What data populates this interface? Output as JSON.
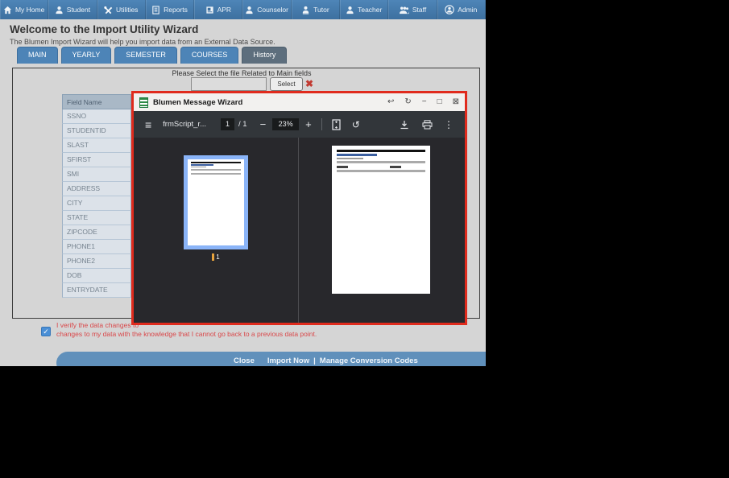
{
  "colors": {
    "navbar_blue": "#4a7fb3",
    "tab_blue": "#4d85b8",
    "tab_active_gray": "#5d6e7d",
    "footer_blue": "#6090bb",
    "alert_red": "#d9484a",
    "modal_border_red": "#e02b1d",
    "pdf_toolbar_dark": "#32363a",
    "thumbnail_selection_blue": "#8ab4f8"
  },
  "navbar": {
    "items": [
      {
        "label": "My Home",
        "icon": "home-icon"
      },
      {
        "label": "Student",
        "icon": "person-icon"
      },
      {
        "label": "Utilities",
        "icon": "tools-icon"
      },
      {
        "label": "Reports",
        "icon": "report-icon"
      },
      {
        "label": "APR",
        "icon": "book-icon"
      },
      {
        "label": "Counselor",
        "icon": "person-icon"
      },
      {
        "label": "Tutor",
        "icon": "person-icon"
      },
      {
        "label": "Teacher",
        "icon": "person-icon"
      },
      {
        "label": "Staff",
        "icon": "people-icon"
      },
      {
        "label": "Admin",
        "icon": "person-circle-icon"
      }
    ]
  },
  "header": {
    "title": "Welcome to the Import Utility Wizard",
    "subtitle": "The Blumen Import Wizard will help you import data from an External Data Source."
  },
  "tabs": [
    {
      "label": "MAIN",
      "active": false
    },
    {
      "label": "YEARLY",
      "active": false
    },
    {
      "label": "SEMESTER",
      "active": false
    },
    {
      "label": "COURSES",
      "active": false
    },
    {
      "label": "History",
      "active": true
    }
  ],
  "file_select": {
    "prompt": "Please Select the file Related to Main fields",
    "input_value": "",
    "select_label": "Select"
  },
  "field_table": {
    "header": "Field Name",
    "rows": [
      "SSNO",
      "STUDENTID",
      "SLAST",
      "SFIRST",
      "SMI",
      "ADDRESS",
      "CITY",
      "STATE",
      "ZIPCODE",
      "PHONE1",
      "PHONE2",
      "DOB",
      "ENTRYDATE"
    ]
  },
  "verify": {
    "checked": true,
    "line1": "I verify the data changes to",
    "line2": "changes to my data with the knowledge that I cannot go back to a previous data point."
  },
  "footer": {
    "close_label": "Close",
    "import_label": "Import Now",
    "pipe": "|",
    "manage_label": "Manage Conversion Codes"
  },
  "modal": {
    "title": "Blumen Message Wizard",
    "toolbar": {
      "filename": "frmScript_r...",
      "page_current": "1",
      "page_total": "/ 1",
      "zoom_level": "23%"
    },
    "thumbnail_page_number": "1"
  },
  "icons": {
    "hamburger": "≡",
    "minus": "−",
    "plus": "+",
    "kebab": "⋮",
    "rotate": "↺",
    "restore": "↩",
    "refresh": "↻",
    "minimize": "−",
    "maximize": "□",
    "close": "⊠",
    "red_x": "✖",
    "check": "✓"
  }
}
